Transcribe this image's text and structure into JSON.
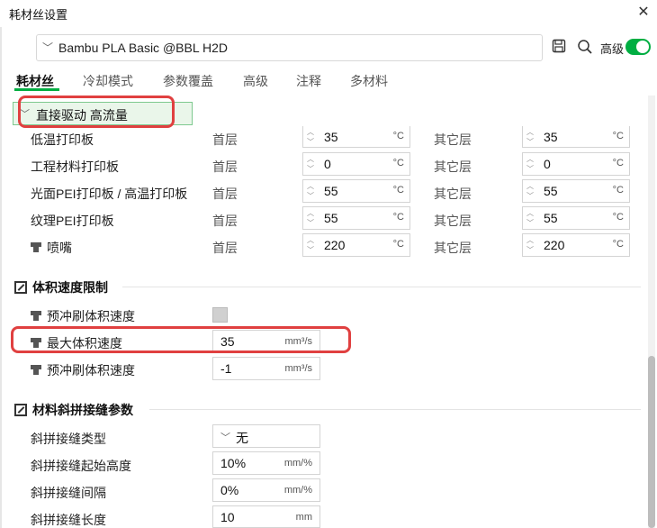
{
  "window": {
    "title": "耗材丝设置",
    "close_glyph": "✕"
  },
  "preset": {
    "name": "Bambu PLA Basic @BBL H2D"
  },
  "toolbar": {
    "advanced_label": "高级",
    "advanced_on": true
  },
  "tabs": [
    {
      "label": "耗材丝",
      "active": true
    },
    {
      "label": "冷却模式",
      "active": false
    },
    {
      "label": "参数覆盖",
      "active": false
    },
    {
      "label": "高级",
      "active": false
    },
    {
      "label": "注释",
      "active": false
    },
    {
      "label": "多材料",
      "active": false
    }
  ],
  "group": {
    "label": "直接驱动 高流量"
  },
  "plate_rows": [
    {
      "label": "低温打印板",
      "first_label": "首层",
      "first_value": "35",
      "other_label": "其它层",
      "other_value": "35",
      "unit": "°C"
    },
    {
      "label": "工程材料打印板",
      "first_label": "首层",
      "first_value": "0",
      "other_label": "其它层",
      "other_value": "0",
      "unit": "°C"
    },
    {
      "label": "光面PEI打印板 / 高温打印板",
      "first_label": "首层",
      "first_value": "55",
      "other_label": "其它层",
      "other_value": "55",
      "unit": "°C"
    },
    {
      "label": "纹理PEI打印板",
      "first_label": "首层",
      "first_value": "55",
      "other_label": "其它层",
      "other_value": "55",
      "unit": "°C"
    },
    {
      "label": "喷嘴",
      "first_label": "首层",
      "first_value": "220",
      "other_label": "其它层",
      "other_value": "220",
      "unit": "°C"
    }
  ],
  "volume_section": {
    "title": "体积速度限制",
    "prime_label": "预冲刷体积速度",
    "prime_checked": false,
    "max_label": "最大体积速度",
    "max_value": "35",
    "max_unit": "mm³/s",
    "prime2_label": "预冲刷体积速度",
    "prime2_value": "-1",
    "prime2_unit": "mm³/s"
  },
  "scarf_section": {
    "title": "材料斜拼接缝参数",
    "type_label": "斜拼接缝类型",
    "type_value": "无",
    "start_label": "斜拼接缝起始高度",
    "start_value": "10%",
    "start_unit": "mm/%",
    "gap_label": "斜拼接缝间隔",
    "gap_value": "0%",
    "gap_unit": "mm/%",
    "length_label": "斜拼接缝长度",
    "length_value": "10",
    "length_unit": "mm"
  },
  "colors": {
    "accent": "#00ae42",
    "highlight_red": "#e04040"
  }
}
